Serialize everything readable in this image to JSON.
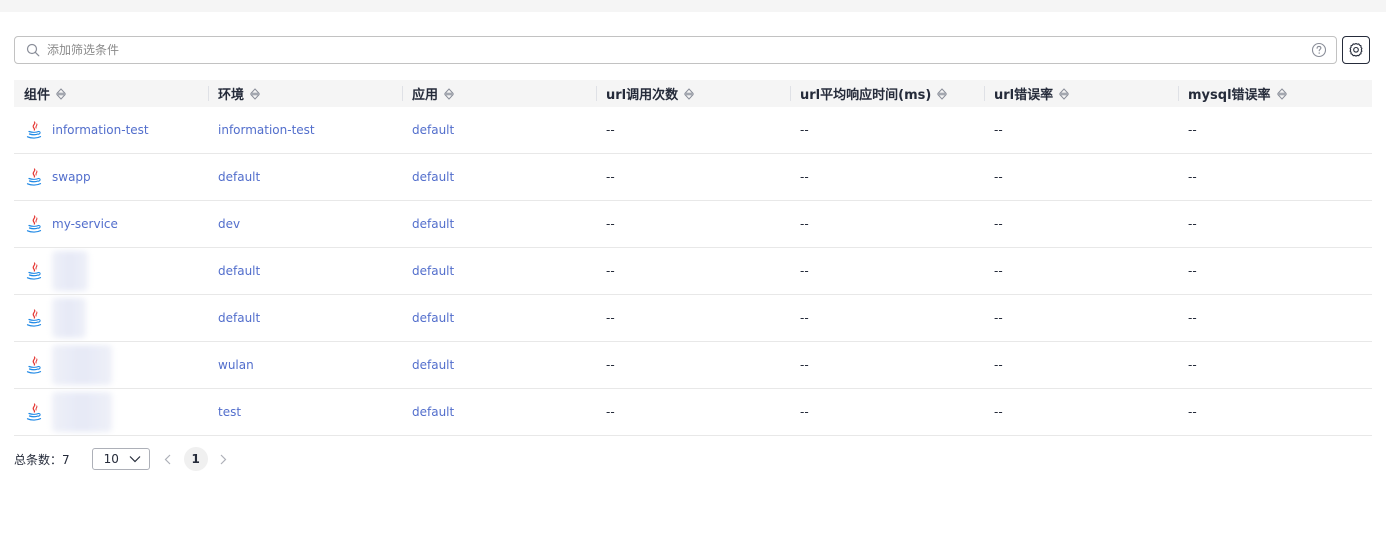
{
  "filter": {
    "placeholder": "添加筛选条件",
    "value": ""
  },
  "table": {
    "columns": [
      "组件",
      "环境",
      "应用",
      "url调用次数",
      "url平均响应时间(ms)",
      "url错误率",
      "mysql错误率"
    ],
    "rows": [
      {
        "component": "information-test",
        "env": "information-test",
        "app": "default",
        "url_calls": "--",
        "url_avg_ms": "--",
        "url_err": "--",
        "mysql_err": "--"
      },
      {
        "component": "swapp",
        "env": "default",
        "app": "default",
        "url_calls": "--",
        "url_avg_ms": "--",
        "url_err": "--",
        "mysql_err": "--"
      },
      {
        "component": "my-service",
        "env": "dev",
        "app": "default",
        "url_calls": "--",
        "url_avg_ms": "--",
        "url_err": "--",
        "mysql_err": "--"
      },
      {
        "component": "",
        "env": "default",
        "app": "default",
        "url_calls": "--",
        "url_avg_ms": "--",
        "url_err": "--",
        "mysql_err": "--"
      },
      {
        "component": "",
        "env": "default",
        "app": "default",
        "url_calls": "--",
        "url_avg_ms": "--",
        "url_err": "--",
        "mysql_err": "--"
      },
      {
        "component": "",
        "env": "wulan",
        "app": "default",
        "url_calls": "--",
        "url_avg_ms": "--",
        "url_err": "--",
        "mysql_err": "--"
      },
      {
        "component": "",
        "env": "test",
        "app": "default",
        "url_calls": "--",
        "url_avg_ms": "--",
        "url_err": "--",
        "mysql_err": "--"
      }
    ]
  },
  "pagination": {
    "total_label": "总条数：7",
    "page_size": "10",
    "current_page": "1"
  },
  "icons": {
    "component": "java-icon",
    "search": "search-icon",
    "help": "help-icon",
    "settings": "gear-icon",
    "sort": "sort-icon"
  },
  "colors": {
    "link": "#526ecc",
    "header_bg": "#f5f5f5"
  }
}
